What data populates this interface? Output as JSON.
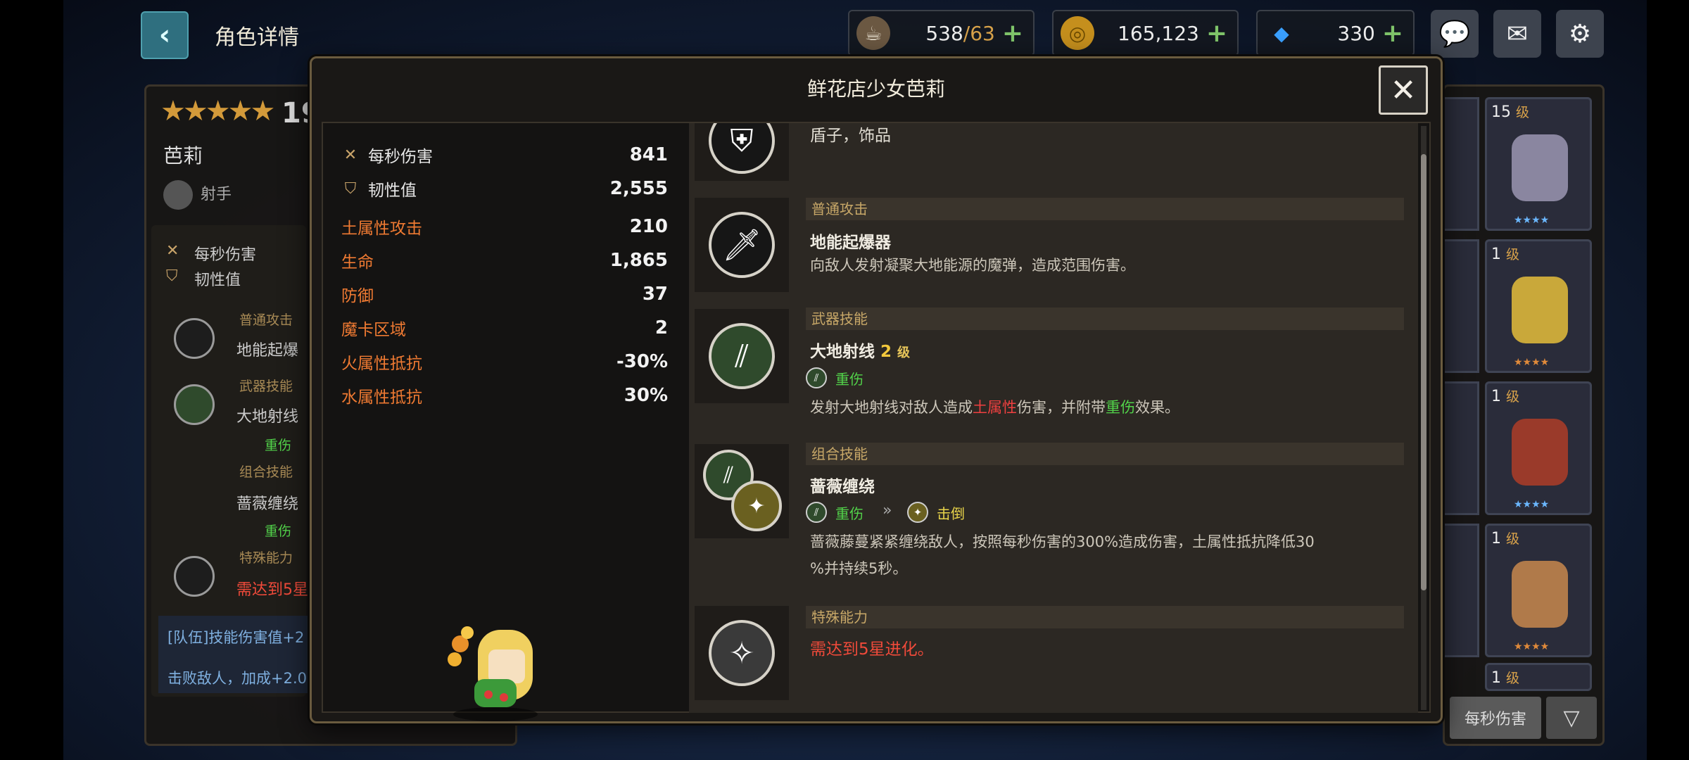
{
  "header": {
    "title": "角色详情",
    "resources": {
      "stamina_current": "538",
      "stamina_max": "/63",
      "gold": "165,123",
      "gems": "330"
    }
  },
  "background_panel": {
    "level": "19",
    "name": "芭莉",
    "role": "射手",
    "stats": [
      "每秒伤害",
      "韧性值"
    ],
    "skills": [
      {
        "category": "普通攻击",
        "name": "地能起爆"
      },
      {
        "category": "武器技能",
        "name": "大地射线",
        "tag": "重伤"
      },
      {
        "category": "组合技能",
        "name": "蔷薇缠绕",
        "tag": "重伤"
      },
      {
        "category": "特殊能力",
        "name": "需达到5星"
      }
    ],
    "team_lines": [
      "[队伍]技能伤害值+2",
      "击败敌人，加成+2.0"
    ]
  },
  "roster": {
    "cards": [
      {
        "level": "15",
        "unit": "级"
      },
      {
        "level": "1",
        "unit": "级"
      },
      {
        "level": "1",
        "unit": "级"
      },
      {
        "level": "1",
        "unit": "级"
      },
      {
        "level": "1",
        "unit": "级"
      }
    ],
    "sort_label": "每秒伤害",
    "filter_icon": "▽"
  },
  "modal": {
    "title": "鲜花店少女芭莉",
    "close_icon": "✕",
    "stats_primary": [
      {
        "icon": "swords-icon",
        "label": "每秒伤害",
        "value": "841"
      },
      {
        "icon": "shield-icon",
        "label": "韧性值",
        "value": "2,555"
      }
    ],
    "stats_secondary": [
      {
        "label": "土属性攻击",
        "value": "210"
      },
      {
        "label": "生命",
        "value": "1,865"
      },
      {
        "label": "防御",
        "value": "37"
      },
      {
        "label": "魔卡区域",
        "value": "2"
      },
      {
        "label": "火属性抵抗",
        "value": "-30%"
      },
      {
        "label": "水属性抵抗",
        "value": "30%"
      }
    ],
    "equipment_text": "盾子，饰品",
    "skills": [
      {
        "category": "普通攻击",
        "name": "地能起爆器",
        "desc": "向敌人发射凝聚大地能源的魔弹，造成范围伤害。"
      },
      {
        "category": "武器技能",
        "name": "大地射线",
        "level": "2",
        "level_unit": "级",
        "tag": "重伤",
        "desc_parts": [
          "发射大地射线对敌人造成",
          "土属性",
          "伤害，并附带",
          "重伤",
          "效果。"
        ]
      },
      {
        "category": "组合技能",
        "name": "蔷薇缠绕",
        "tag_from": "重伤",
        "tag_to": "击倒",
        "desc_line1": "蔷薇藤蔓紧紧缠绕敌人，按照每秒伤害的300%造成伤害，土属性抵抗降低30",
        "desc_line2": "%并持续5秒。"
      },
      {
        "category": "特殊能力",
        "name": "需达到5星进化。"
      }
    ]
  },
  "colors": {
    "accent_orange": "#ef7a32",
    "highlight_red": "#f04040",
    "highlight_green": "#52d34a",
    "level_gold": "#f2c83c"
  }
}
